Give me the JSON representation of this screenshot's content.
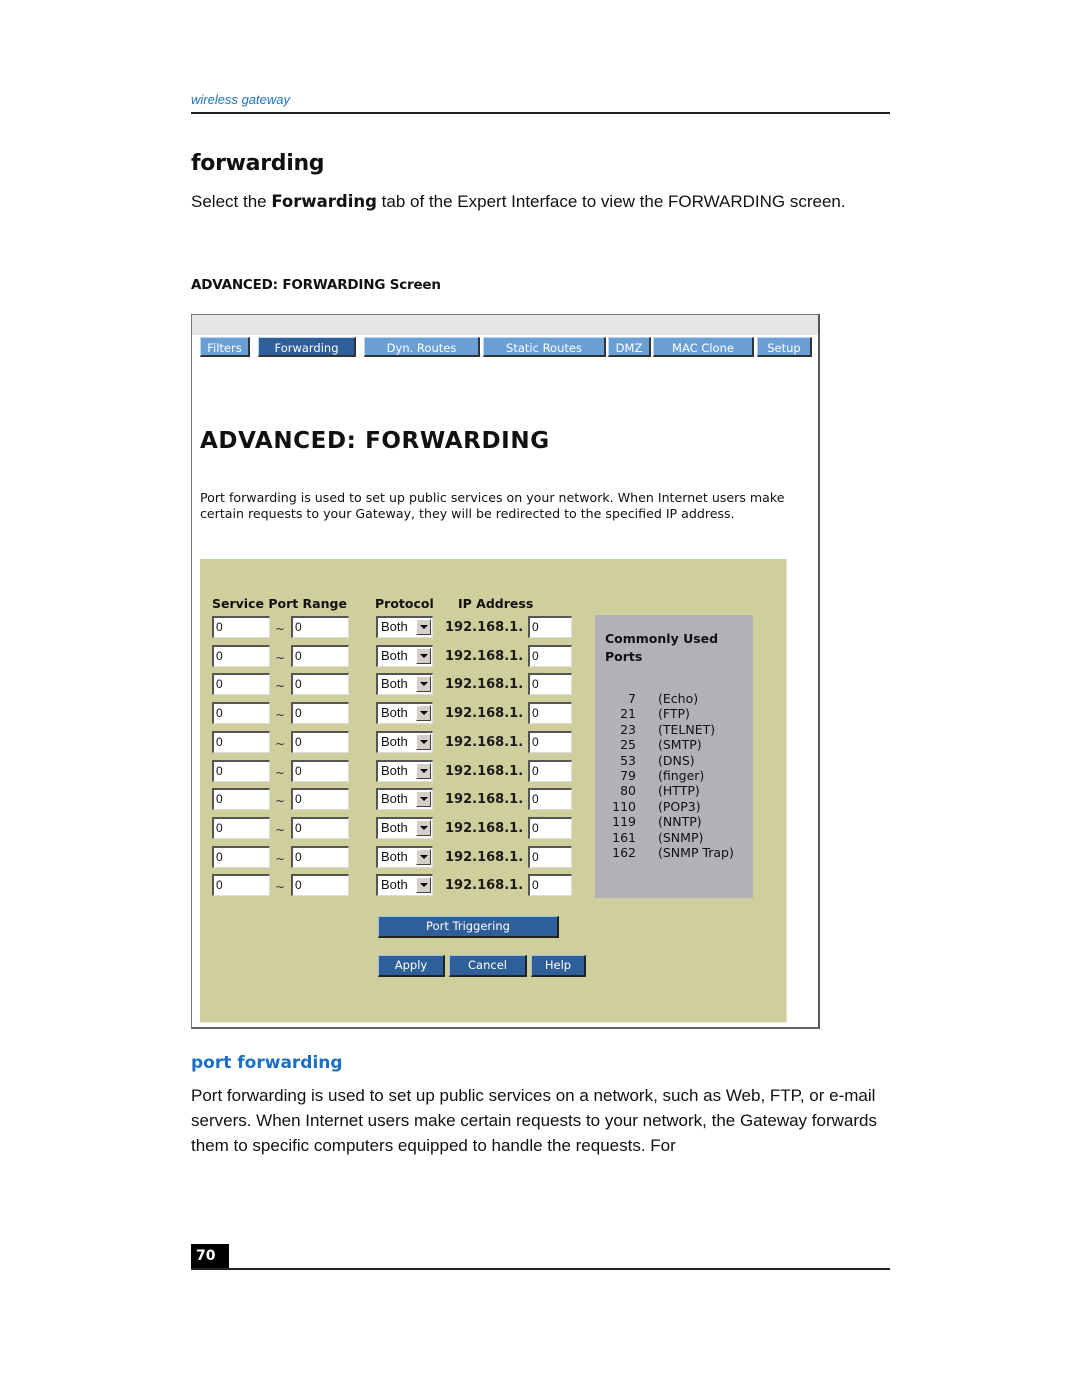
{
  "running_head": "wireless gateway",
  "section_title": "forwarding",
  "intro": {
    "before": "Select the ",
    "bold": "Forwarding",
    "after": " tab of the Expert Interface to view the FORWARDING screen."
  },
  "figure_caption": "ADVANCED: FORWARDING Screen",
  "screen": {
    "tabs": [
      {
        "label": "Filters",
        "active": false
      },
      {
        "label": "Forwarding",
        "active": true
      },
      {
        "label": "Dyn. Routes",
        "active": false
      },
      {
        "label": "Static Routes",
        "active": false
      },
      {
        "label": "DMZ",
        "active": false
      },
      {
        "label": "MAC Clone",
        "active": false
      },
      {
        "label": "Setup",
        "active": false
      }
    ],
    "title": "ADVANCED: FORWARDING",
    "description": "Port forwarding is used to set up public services on your network. When Internet users make certain requests to your Gateway, they will be redirected to the specified IP address.",
    "columns": {
      "service_port_range": "Service Port Range",
      "protocol": "Protocol",
      "ip_address": "IP Address"
    },
    "range_separator": "~",
    "ip_prefix": "192.168.1.",
    "rows": [
      {
        "port_start": "0",
        "port_end": "0",
        "protocol": "Both",
        "ip_last": "0"
      },
      {
        "port_start": "0",
        "port_end": "0",
        "protocol": "Both",
        "ip_last": "0"
      },
      {
        "port_start": "0",
        "port_end": "0",
        "protocol": "Both",
        "ip_last": "0"
      },
      {
        "port_start": "0",
        "port_end": "0",
        "protocol": "Both",
        "ip_last": "0"
      },
      {
        "port_start": "0",
        "port_end": "0",
        "protocol": "Both",
        "ip_last": "0"
      },
      {
        "port_start": "0",
        "port_end": "0",
        "protocol": "Both",
        "ip_last": "0"
      },
      {
        "port_start": "0",
        "port_end": "0",
        "protocol": "Both",
        "ip_last": "0"
      },
      {
        "port_start": "0",
        "port_end": "0",
        "protocol": "Both",
        "ip_last": "0"
      },
      {
        "port_start": "0",
        "port_end": "0",
        "protocol": "Both",
        "ip_last": "0"
      },
      {
        "port_start": "0",
        "port_end": "0",
        "protocol": "Both",
        "ip_last": "0"
      }
    ],
    "common_ports": {
      "title": "Commonly Used Ports",
      "items": [
        {
          "port": "7",
          "name": "(Echo)"
        },
        {
          "port": "21",
          "name": "(FTP)"
        },
        {
          "port": "23",
          "name": "(TELNET)"
        },
        {
          "port": "25",
          "name": "(SMTP)"
        },
        {
          "port": "53",
          "name": "(DNS)"
        },
        {
          "port": "79",
          "name": "(finger)"
        },
        {
          "port": "80",
          "name": "(HTTP)"
        },
        {
          "port": "110",
          "name": "(POP3)"
        },
        {
          "port": "119",
          "name": "(NNTP)"
        },
        {
          "port": "161",
          "name": "(SNMP)"
        },
        {
          "port": "162",
          "name": "(SNMP Trap)"
        }
      ]
    },
    "buttons": {
      "port_triggering": "Port Triggering",
      "apply": "Apply",
      "cancel": "Cancel",
      "help": "Help"
    }
  },
  "subsection_title": "port forwarding",
  "body_text": "Port forwarding is used to set up public services on a network, such as Web, FTP, or e-mail servers. When Internet users make certain requests to your network, the Gateway forwards them to specific computers equipped to handle the requests. For",
  "page_number": "70",
  "colors": {
    "accent_blue": "#1b6fc4",
    "tab_inactive": "#6a9fd6",
    "tab_active": "#2e5f99",
    "panel_bg": "#cfcf9e",
    "ports_box_bg": "#b1b1b7"
  }
}
